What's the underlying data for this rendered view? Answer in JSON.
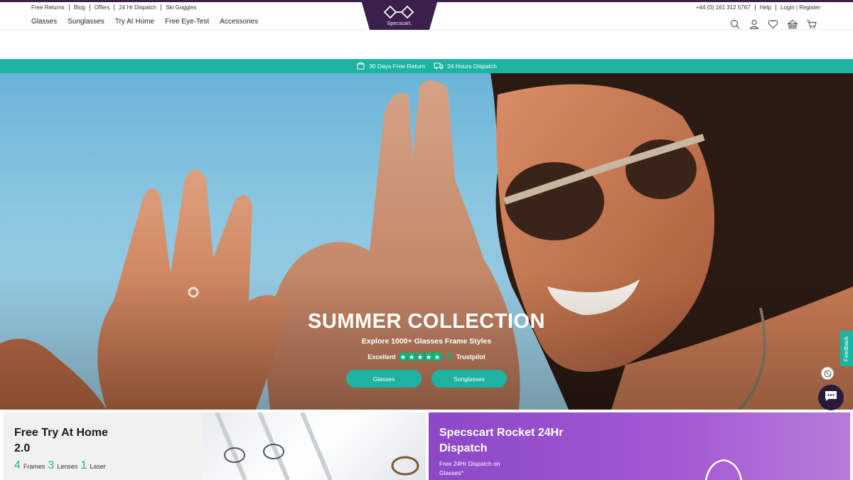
{
  "util_links": [
    "Free Returns",
    "Blog",
    "Offers",
    "24 Hr Dispatch",
    "Ski Goggles"
  ],
  "contact": {
    "phone": "+44 (0) 161 312 5767",
    "help": "Help",
    "login_register": "Login | Register"
  },
  "nav": [
    "Glasses",
    "Sunglasses",
    "Try At Home",
    "Free Eye-Test",
    "Accessories"
  ],
  "brand": {
    "name": "Specscart.",
    "color": "#3b1f4d"
  },
  "header_icons": [
    "search-icon",
    "account-icon",
    "wishlist-icon",
    "try-at-home-icon",
    "cart-icon"
  ],
  "promo_bar": {
    "items": [
      {
        "text": "30 Days Free Return",
        "icon": "return-box-icon"
      },
      {
        "text": "24 Hours Dispatch",
        "icon": "delivery-truck-icon"
      }
    ],
    "color": "#1eb3a1"
  },
  "hero": {
    "title": "SUMMER COLLECTION",
    "subtitle": "Explore 1000+ Glasses Frame Styles",
    "rating_label": "Excellent",
    "rating_source": "Trustpilot",
    "rating_stars": 5,
    "buttons": [
      "Glasses",
      "Sunglasses"
    ]
  },
  "feedback_tab": "Feedback",
  "card_try_home": {
    "title": "Free Try At Home 2.0",
    "stats": [
      {
        "num": "4",
        "label": "Frames"
      },
      {
        "num": "3",
        "label": "Lenses"
      },
      {
        "num": "1",
        "label": "Laser"
      }
    ]
  },
  "card_rocket": {
    "title": "Specscart Rocket 24Hr Dispatch",
    "desc": "Free 24Hr Dispatch on Glasses*"
  },
  "colors": {
    "teal": "#1eb3a1",
    "purple": "#8b48c7",
    "dark": "#3b1f4d"
  }
}
